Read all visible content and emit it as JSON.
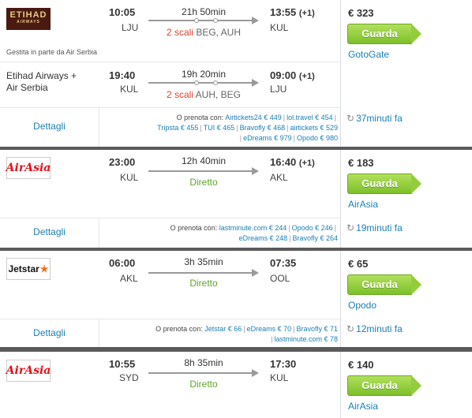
{
  "results": [
    {
      "price": "€ 323",
      "button": "Guarda",
      "provider": "GotoGate",
      "details": "Dettagli",
      "updated": "37minuti fa",
      "operated": "Gestita in parte da Air Serbia",
      "legs": [
        {
          "airline": "Etihad Airways",
          "dep_time": "10:05",
          "dep_code": "LJU",
          "duration": "21h 50min",
          "arr_time": "13:55",
          "plus": "(+1)",
          "arr_code": "KUL",
          "stops": "2 scali",
          "via": "BEG, AUH"
        },
        {
          "airline_line1": "Etihad Airways +",
          "airline_line2": "Air Serbia",
          "dep_time": "19:40",
          "dep_code": "KUL",
          "duration": "19h 20min",
          "arr_time": "09:00",
          "plus": "(+1)",
          "arr_code": "LJU",
          "stops": "2 scali",
          "via": "AUH, BEG"
        }
      ],
      "also_prefix": "O prenota con:",
      "also": [
        "Airtickets24 € 449",
        "lol.travel € 454",
        "Tripsta € 455",
        "TUI € 465",
        "Bravofly € 468",
        "airtickets € 529",
        "eDreams € 979",
        "Opodo € 980"
      ]
    },
    {
      "price": "€ 183",
      "button": "Guarda",
      "provider": "AirAsia",
      "details": "Dettagli",
      "updated": "19minuti fa",
      "legs": [
        {
          "airline": "AirAsia",
          "dep_time": "23:00",
          "dep_code": "KUL",
          "duration": "12h 40min",
          "arr_time": "16:40",
          "plus": "(+1)",
          "arr_code": "AKL",
          "direct": "Diretto"
        }
      ],
      "also_prefix": "O prenota con:",
      "also": [
        "lastminute.com € 244",
        "Opodo € 246",
        "eDreams € 248",
        "Bravofly € 264"
      ]
    },
    {
      "price": "€ 65",
      "button": "Guarda",
      "provider": "Opodo",
      "details": "Dettagli",
      "updated": "12minuti fa",
      "legs": [
        {
          "airline": "Jetstar",
          "dep_time": "06:00",
          "dep_code": "AKL",
          "duration": "3h 35min",
          "arr_time": "07:35",
          "arr_code": "OOL",
          "direct": "Diretto"
        }
      ],
      "also_prefix": "O prenota con:",
      "also": [
        "Jetstar € 66",
        "eDreams € 70",
        "Bravofly € 71",
        "lastminute.com € 78"
      ]
    },
    {
      "price": "€ 140",
      "button": "Guarda",
      "provider": "AirAsia",
      "legs": [
        {
          "airline": "AirAsia",
          "dep_time": "10:55",
          "dep_code": "SYD",
          "duration": "8h 35min",
          "arr_time": "17:30",
          "arr_code": "KUL",
          "direct": "Diretto"
        }
      ]
    }
  ],
  "logos": {
    "etihad_main": "ETIHAD",
    "etihad_sub": "AIRWAYS",
    "airasia": "AirAsia",
    "jetstar": "Jetstar"
  }
}
